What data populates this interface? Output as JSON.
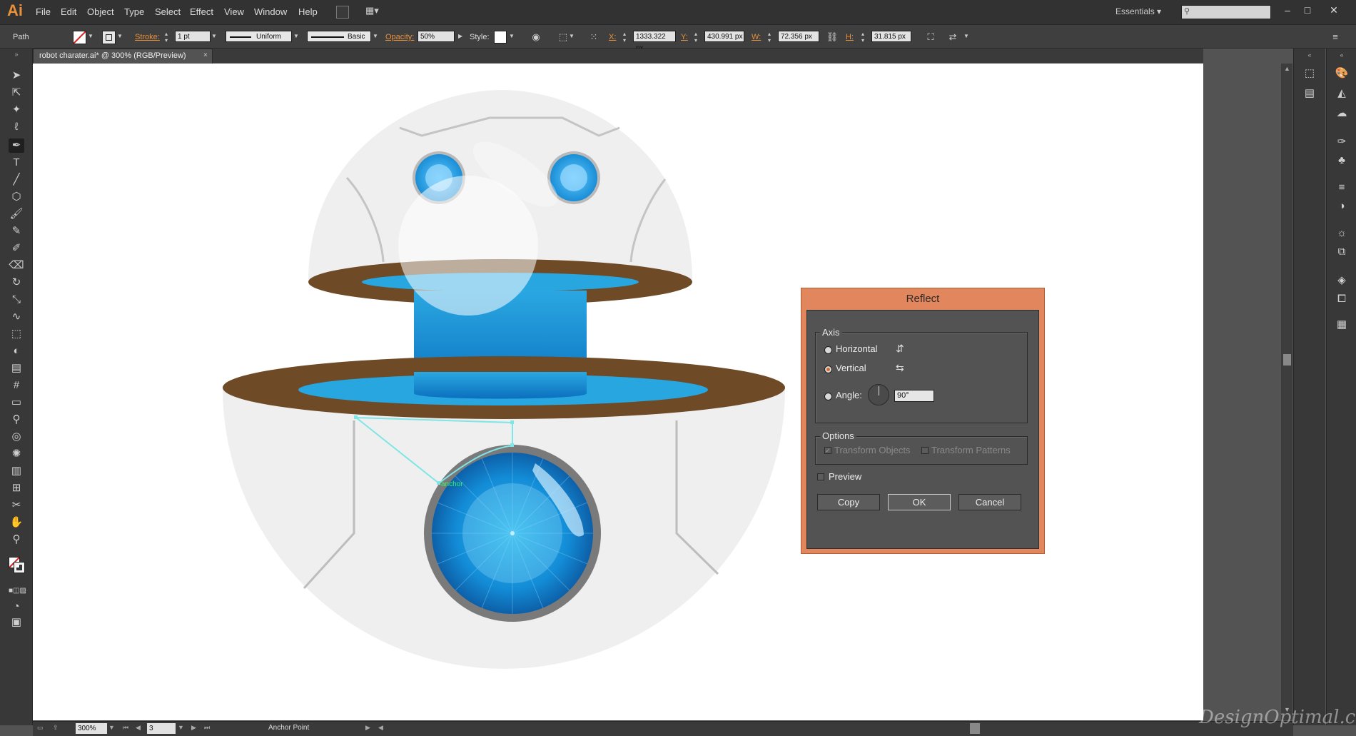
{
  "app": {
    "logo": "Ai",
    "workspace": "Essentials",
    "search_placeholder": ""
  },
  "menu": [
    "File",
    "Edit",
    "Object",
    "Type",
    "Select",
    "Effect",
    "View",
    "Window",
    "Help"
  ],
  "control_bar": {
    "selection_type": "Path",
    "stroke_label": "Stroke:",
    "stroke_value": "1 pt",
    "profile_uniform": "Uniform",
    "brush_basic": "Basic",
    "opacity_label": "Opacity:",
    "opacity_value": "50%",
    "style_label": "Style:",
    "x_label": "X:",
    "x_value": "1333.322 px",
    "y_label": "Y:",
    "y_value": "430.991 px",
    "w_label": "W:",
    "w_value": "72.356 px",
    "h_label": "H:",
    "h_value": "31.815 px"
  },
  "document_tab": {
    "title": "robot charater.ai* @ 300% (RGB/Preview)",
    "close": "×"
  },
  "canvas": {
    "anchor_hint": "anchor"
  },
  "status_bar": {
    "zoom": "300%",
    "artboard": "3",
    "tool_name": "Anchor Point"
  },
  "dialog": {
    "title": "Reflect",
    "axis_group": "Axis",
    "horizontal": "Horizontal",
    "vertical": "Vertical",
    "angle_label": "Angle:",
    "angle_value": "90°",
    "selected_axis": "vertical",
    "options_group": "Options",
    "transform_objects": "Transform Objects",
    "transform_patterns": "Transform Patterns",
    "preview": "Preview",
    "copy": "Copy",
    "ok": "OK",
    "cancel": "Cancel"
  },
  "watermark": "DesignOptimal.com",
  "colors": {
    "accent": "#e8913a",
    "dialog_border": "#e2875d",
    "brown": "#6e4a26",
    "blue": "#28a6e0",
    "dark_blue": "#0a6fbf",
    "body": "#efefef"
  }
}
